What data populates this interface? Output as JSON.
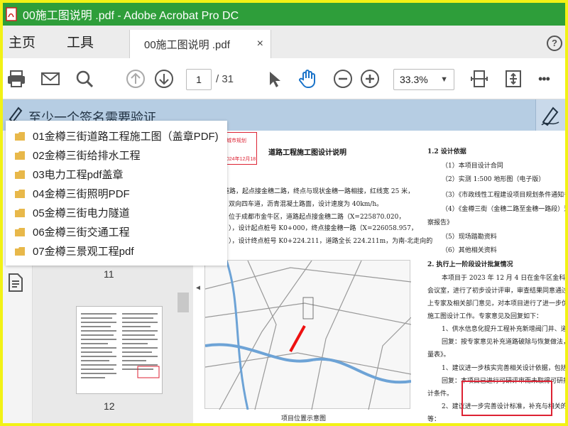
{
  "window": {
    "title": "00施工图说明 .pdf - Adobe Acrobat Pro DC"
  },
  "menu": {
    "home": "主页",
    "tools": "工具",
    "tab_label": "00施工图说明 .pdf",
    "tab_close": "×"
  },
  "toolbar": {
    "page_current": "1",
    "page_total": "/ 31",
    "zoom": "33.3%",
    "zoom_caret": "▼",
    "more": "•••"
  },
  "signature_banner": {
    "text": "至少一个签名需要验证"
  },
  "bookmarks": [
    "01金樽三街道路工程施工图（盖章PDF)",
    "02金樽三街给排水工程",
    "03电力工程pdf盖章",
    "04金樽三街照明PDF",
    "05金樽三街电力隧道",
    "06金樽三街交通工程",
    "07金樽三景观工程pdf"
  ],
  "thumbnails": {
    "page_a": "11",
    "page_b": "12"
  },
  "document": {
    "title": "道路工程施工图设计说明",
    "left_lines": [
      "市政道路，起点接金穗二路，终点与现状金穗一路相接，红线宽 25 米，",
      "双向四车道，沥青混凝土路面，设计速度为 40km/h。",
      "位于成都市金牛区，道路起点接金穗二路（X=225870.020，",
      "），设计起点桩号 K0+000，终点接金穗一路（X=226058.957，",
      "），设计终点桩号 K0+224.211，道路全长 224.211m，为南-北走向的"
    ],
    "right_heading_1": "1.2  设计依据",
    "right_list": [
      "（1）本项目设计合同",
      "（2）实测 1:500 地形图（电子版）",
      "（3）《市政线性工程建设项目规划条件通知书》",
      "（4）《金樽三街（金穗二路至金穗一路段）道路",
      "察报告》",
      "（5）现场踏勘资料",
      "（6）其他相关资料"
    ],
    "right_heading_2": "2.  执行上一阶段设计批复情况",
    "right_para": [
      "本项目于 2023 年 12 月 4 日在金牛区金科南二",
      "会议室，进行了初步设计评审，审查结果同意通过",
      "上专家及相关部门意见，对本项目进行了进一步优",
      "施工图设计工作。专家意见及回复如下：",
      "1、供水信息化提升工程补充新增阀门井、道路",
      "回复：按专家意见补充道路破除与恢复做法，",
      "量表》。",
      "1、建议进一步核实完善相关设计依据，包括可",
      "回复：本项目已进行可研评审而未取得可研批",
      "计条件。",
      "2、建议进一步完善设计标准，补充与相关的规划",
      "等："
    ],
    "map_caption": "项目位置示意图",
    "stamp_top": "2024年12月18",
    "stamp_top_2": "城市规划"
  }
}
